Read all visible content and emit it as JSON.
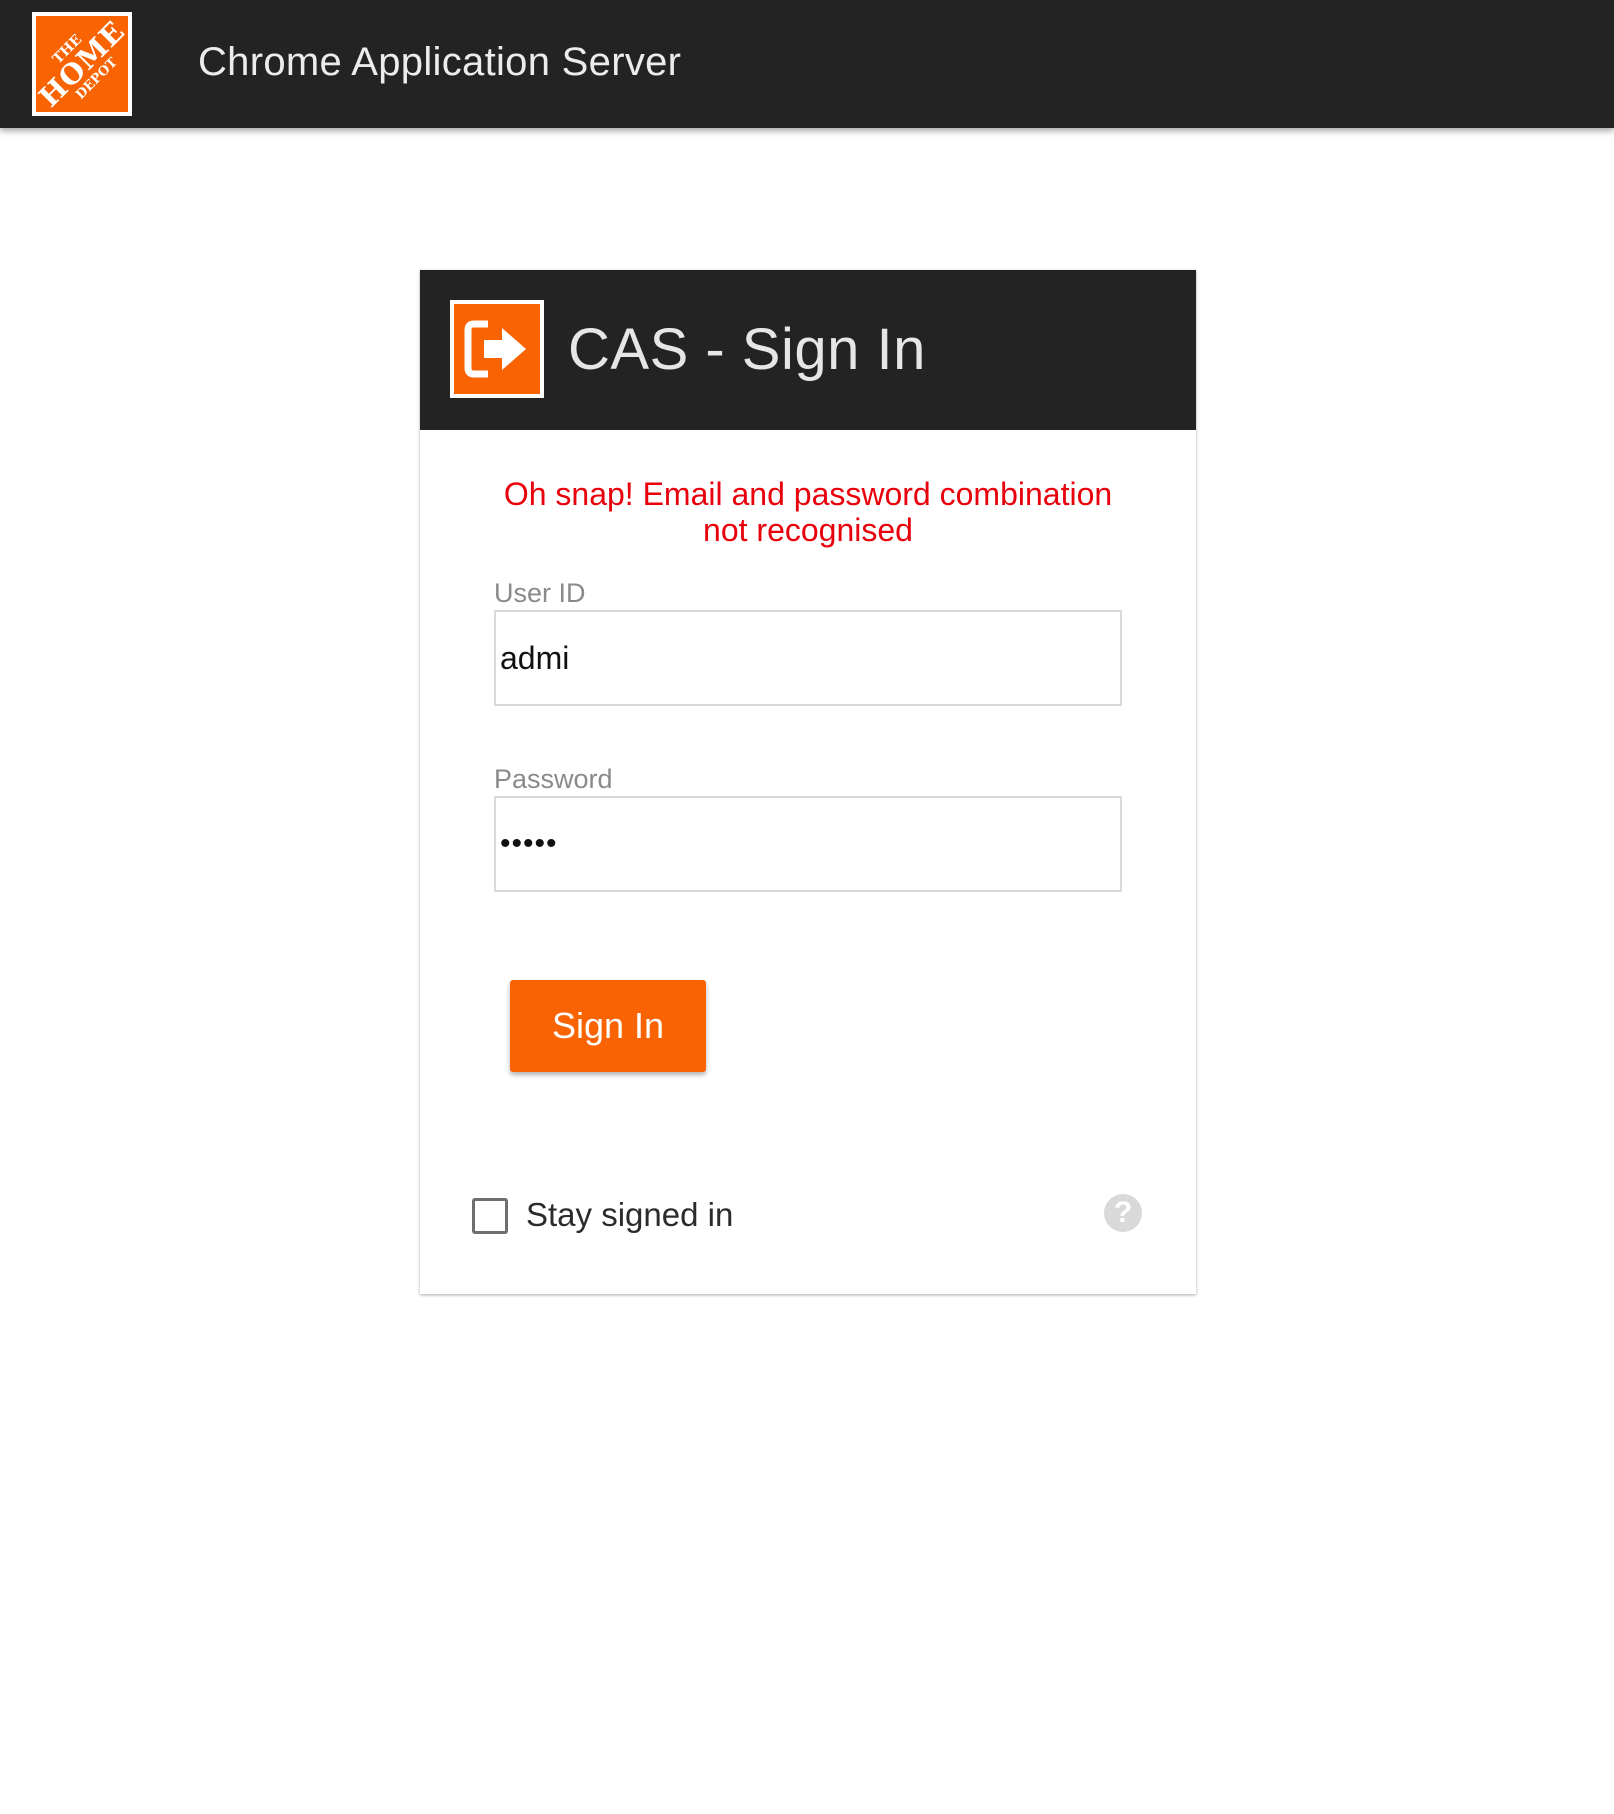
{
  "header": {
    "app_title": "Chrome Application Server",
    "logo": {
      "name": "home-depot-logo",
      "line1": "THE",
      "line2": "HOME",
      "line3": "DEPOT"
    }
  },
  "card": {
    "title": "CAS - Sign In",
    "icon": "sign-in-arrow-icon",
    "error_message": "Oh snap! Email and password combination not recognised",
    "user_id": {
      "label": "User ID",
      "value": "admi"
    },
    "password": {
      "label": "Password",
      "value": "•••••"
    },
    "sign_in_label": "Sign In",
    "stay_signed_in_label": "Stay signed in",
    "stay_signed_in_checked": false,
    "help_icon": "help-question-icon"
  },
  "colors": {
    "accent": "#f96302",
    "header_bg": "#232323",
    "error": "#e8000b"
  }
}
